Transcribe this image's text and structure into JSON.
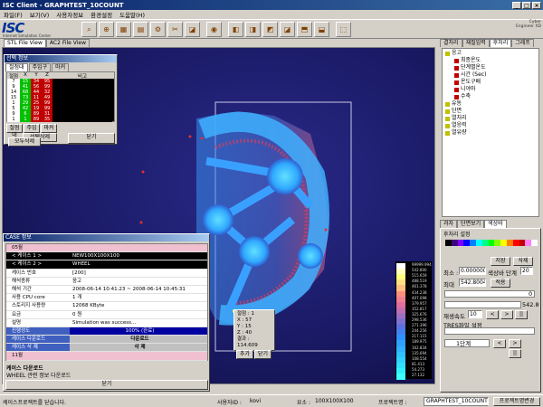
{
  "app_title": "ISC Client - GRAPHTEST_10COUNT",
  "menu": [
    "파일(F)",
    "보기(V)",
    "사용자정보",
    "환경설정",
    "도움말(H)"
  ],
  "logo": {
    "text": "ISC",
    "sub": "Internet Simulation Center",
    "right_line1": "Cyber",
    "right_line2": "Engineer XD"
  },
  "view_tabs": [
    "STL File View",
    "AC2 File View"
  ],
  "select_panel": {
    "title": "선택 정보",
    "tabs": [
      "절점대",
      "주입구",
      "마커"
    ],
    "headers": [
      "절점",
      "X",
      "Y",
      "Z",
      "비고"
    ],
    "rows": [
      [
        "7",
        "15",
        "34",
        "95"
      ],
      [
        "9",
        "41",
        "56",
        "99"
      ],
      [
        "14",
        "68",
        "44",
        "32"
      ],
      [
        "15",
        "73",
        "11",
        "49"
      ],
      [
        "1",
        "29",
        "25",
        "99"
      ],
      [
        "5",
        "42",
        "19",
        "99"
      ],
      [
        "9",
        "6",
        "89",
        "31"
      ],
      [
        "1",
        "1",
        "89",
        "35"
      ]
    ],
    "btns": [
      "절점대",
      "주입구",
      "마커"
    ],
    "btn_select_delete": "선택삭제",
    "btn_all_delete": "모두삭제",
    "btn_close": "닫기"
  },
  "case_panel": {
    "title": "CASE 정보",
    "items": [
      {
        "label": "05월",
        "value": ""
      },
      {
        "label": "< 케이스 1 >",
        "value": "NEW100X100X100"
      },
      {
        "label": "< 케이스 2 >",
        "value": "WHEEL"
      },
      {
        "label": "케이스 번호",
        "value": "[200]"
      },
      {
        "label": "해석종류",
        "value": "응고"
      },
      {
        "label": "해석 기간",
        "value": "2008-06-14 10:41:23 ~ 2008-06-14 10:45:31"
      },
      {
        "label": "사용 CPU core",
        "value": "1 개"
      },
      {
        "label": "스토리지 사용량",
        "value": "12068 KByte"
      },
      {
        "label": "요금",
        "value": "0 원"
      },
      {
        "label": "설명",
        "value": "Simulation was success..."
      },
      {
        "label": "진행정도",
        "value": "100% (완료)"
      },
      {
        "label": "케이스 다운로드",
        "value": "다운로드"
      },
      {
        "label": "케이스 삭 제",
        "value": "삭 제"
      },
      {
        "label": "11월",
        "value": ""
      }
    ],
    "desc_title": "케이스 다운로드",
    "desc_text": "WHEEL 관련 정보 다운로드",
    "btn_close": "닫기"
  },
  "probe": {
    "label_node": "절점",
    "node": "1",
    "x_label": "X",
    "x": "57",
    "y_label": "Y",
    "y": "15",
    "z_label": "Z",
    "z": "40",
    "result_label": "결과",
    "result": "114.609",
    "btn_add": "추가",
    "btn_close": "닫기"
  },
  "right_tabs": [
    "결처리",
    "재질입력",
    "후처리",
    "그래프"
  ],
  "tree": [
    {
      "label": "응고",
      "level": 0,
      "color": "#c0c000"
    },
    {
      "label": "최종온도",
      "level": 1,
      "color": "#c00000"
    },
    {
      "label": "단계별온도",
      "level": 1,
      "color": "#c00000"
    },
    {
      "label": "시간 (Sec)",
      "level": 1,
      "color": "#c00000"
    },
    {
      "label": "온도구배",
      "level": 1,
      "color": "#c00000"
    },
    {
      "label": "니야마",
      "level": 1,
      "color": "#c00000"
    },
    {
      "label": "수축",
      "level": 1,
      "color": "#c00000"
    },
    {
      "label": "유동",
      "level": 0,
      "color": "#c0c000"
    },
    {
      "label": "단면",
      "level": 0,
      "color": "#c0c000"
    },
    {
      "label": "열처리",
      "level": 0,
      "color": "#c0c000"
    },
    {
      "label": "열응력",
      "level": 0,
      "color": "#c0c000"
    },
    {
      "label": "열유량",
      "level": 0,
      "color": "#c0c000"
    }
  ],
  "lower_tabs": [
    "과자",
    "단면보기",
    "색상바"
  ],
  "color_settings": {
    "title": "후처리 설정",
    "btn_save": "저장",
    "btn_delete": "삭제",
    "min_label": "최소 :",
    "min_value": "0.000000",
    "steps_label": "색상바 단계",
    "steps_value": "20",
    "max_label": "최대",
    "max_value": "542.8004",
    "btn_apply": "적용",
    "slider_min": "0",
    "slider_max": "542.8",
    "speed_label": "재생속도",
    "speed_value": "10",
    "tres_label": "TRES파일 설정",
    "step_label": "1단계"
  },
  "legend_values": [
    "99999.994",
    "542.800",
    "515.659",
    "488.519",
    "461.378",
    "434.238",
    "407.098",
    "379.957",
    "352.817",
    "325.676",
    "298.536",
    "271.396",
    "244.256",
    "217.115",
    "189.975",
    "162.834",
    "135.694",
    "108.554",
    "81.413",
    "54.273",
    "27.132"
  ],
  "status": {
    "left": "케이스프로젝트를 닫습니다.",
    "user_label": "사용자ID :",
    "user": "kovi",
    "mesh_label": "요소 :",
    "mesh": "100X100X100",
    "project_label": "프로젝트명 :",
    "project": "GRAPHTEST_10COUNT",
    "btn_project": "프로젝트명변경"
  }
}
